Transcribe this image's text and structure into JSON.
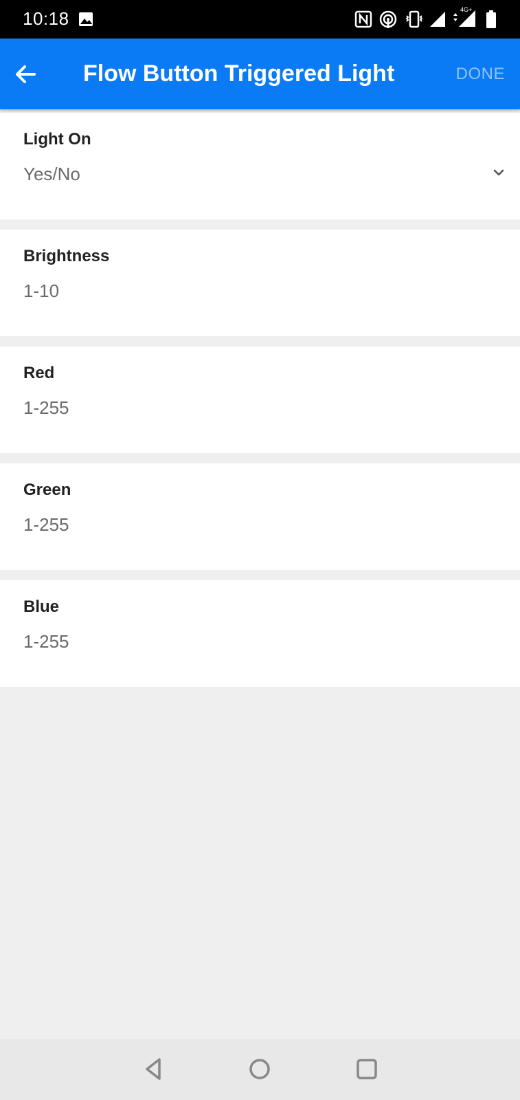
{
  "status_bar": {
    "time": "10:18",
    "icons": [
      "image-icon",
      "nfc-icon",
      "hotspot-icon",
      "vibrate-icon",
      "wifi-signal-icon",
      "cellular-4g-icon",
      "battery-icon"
    ],
    "network_label": "4G+"
  },
  "app_bar": {
    "title": "Flow Button Triggered Light",
    "back_icon": "arrow-left-icon",
    "done_label": "DONE",
    "color": "#0a7bf5"
  },
  "fields": [
    {
      "label": "Light On",
      "value": "Yes/No",
      "has_dropdown": true
    },
    {
      "label": "Brightness",
      "value": "1-10"
    },
    {
      "label": "Red",
      "value": "1-255"
    },
    {
      "label": "Green",
      "value": "1-255"
    },
    {
      "label": "Blue",
      "value": "1-255"
    }
  ],
  "nav_bar": {
    "icons": [
      "back-triangle-icon",
      "home-circle-icon",
      "recents-square-icon"
    ]
  }
}
